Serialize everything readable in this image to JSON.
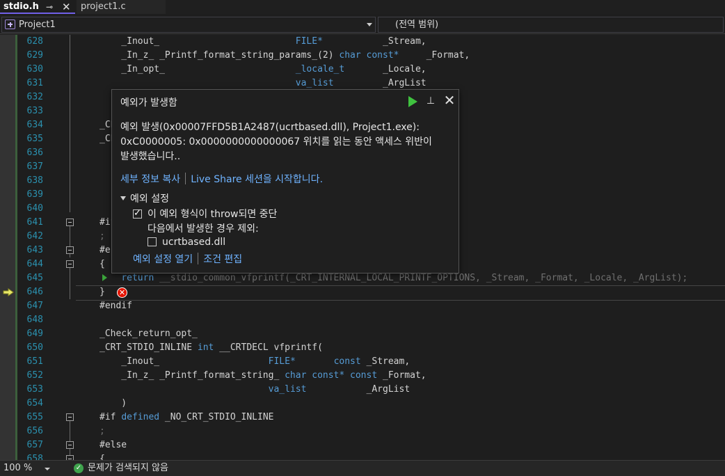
{
  "tabs": [
    {
      "label": "stdio.h",
      "pin_icon": "pin-icon",
      "close_icon": "close-icon"
    },
    {
      "label": "project1.c"
    }
  ],
  "navbar": {
    "project": "Project1",
    "scope": "(전역 범위)"
  },
  "popup": {
    "title": "예외가 발생함",
    "message_line1": "예외 발생(0x00007FFD5B1A2487(ucrtbased.dll), Project1.exe):",
    "message_line2": "0xC0000005: 0x0000000000000067 위치를 읽는 동안 액세스 위반이",
    "message_line3": "발생했습니다..",
    "link_copy_details": "세부 정보 복사",
    "link_live_share": "Live Share 세션을 시작합니다.",
    "settings_header": "예외 설정",
    "break_when_thrown": "이 예외 형식이 throw되면 중단",
    "break_when_thrown_checked": true,
    "except_when_label": "다음에서 발생한 경우 제외:",
    "module_option": "ucrtbased.dll",
    "module_option_checked": false,
    "link_open_settings": "예외 설정 열기",
    "link_edit_conditions": "조건 편집"
  },
  "code": {
    "628": "    _Inout_                         FILE*           _Stream,",
    "629": "    _In_z_ _Printf_format_string_params_(2) char const*     _Format,",
    "630": "    _In_opt_                        _locale_t       _Locale,",
    "631": "                                    va_list         _ArgList",
    "634": "_Ch",
    "635": "_Ch",
    "641": "#if",
    "642": ";",
    "643": "#e",
    "644": "{",
    "645": "    return __stdio_common_vfprintf(_CRT_INTERNAL_LOCAL_PRINTF_OPTIONS, _Stream, _Format, _Locale, _ArgList);",
    "646": "}",
    "647": "#endif",
    "649": "_Check_return_opt_",
    "650": "_CRT_STDIO_INLINE int __CRTDECL vfprintf(",
    "651": "    _Inout_                    FILE*       const _Stream,",
    "652": "    _In_z_ _Printf_format_string_ char const* const _Format,",
    "653": "                               va_list           _ArgList",
    "654": "    )",
    "655": "#if defined _NO_CRT_STDIO_INLINE",
    "656": ";",
    "657": "#else",
    "658": "{"
  },
  "statusbar": {
    "zoom": "100 %",
    "issues": "문제가 검색되지 않음"
  },
  "colors": {
    "accent": "#7160e8",
    "keyword": "#569cd6",
    "line_number": "#2b91af",
    "link": "#6fb3ff",
    "error": "#e51400",
    "continue": "#3fc23f"
  }
}
